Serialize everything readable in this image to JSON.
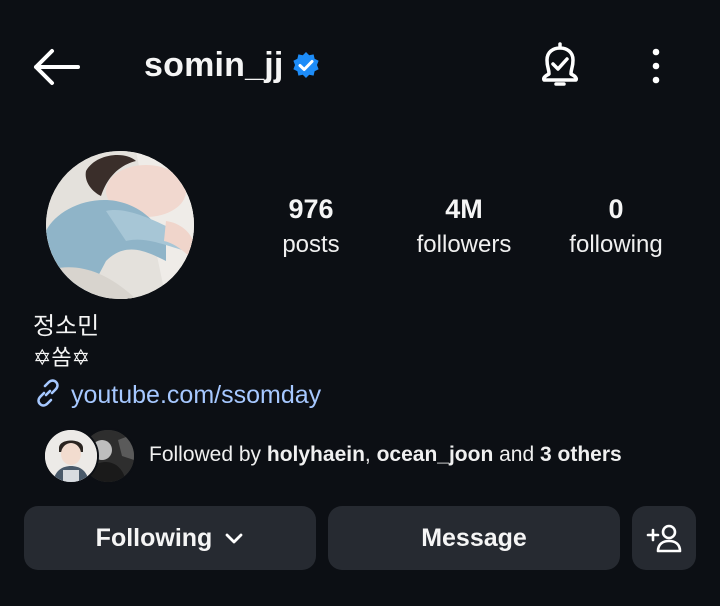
{
  "header": {
    "username": "somin_jj",
    "verified": true,
    "icons": [
      "back-arrow-icon",
      "verified-badge-icon",
      "notification-bell-icon",
      "more-options-icon"
    ]
  },
  "stats": {
    "posts": {
      "value": "976",
      "label": "posts"
    },
    "followers": {
      "value": "4M",
      "label": "followers"
    },
    "following": {
      "value": "0",
      "label": "following"
    }
  },
  "profile": {
    "full_name": "정소민",
    "bio": "✡쏨✡",
    "link": "youtube.com/ssomday"
  },
  "followed_by": {
    "prefix": "Followed by ",
    "user1": "holyhaein",
    "separator": ", ",
    "user2": "ocean_joon",
    "middle": " and ",
    "others": "3 others"
  },
  "actions": {
    "following_label": "Following",
    "message_label": "Message"
  },
  "colors": {
    "background": "#0c0f14",
    "button": "#262a31",
    "link": "#a6c8ff",
    "verified": "#1d8cf8"
  }
}
